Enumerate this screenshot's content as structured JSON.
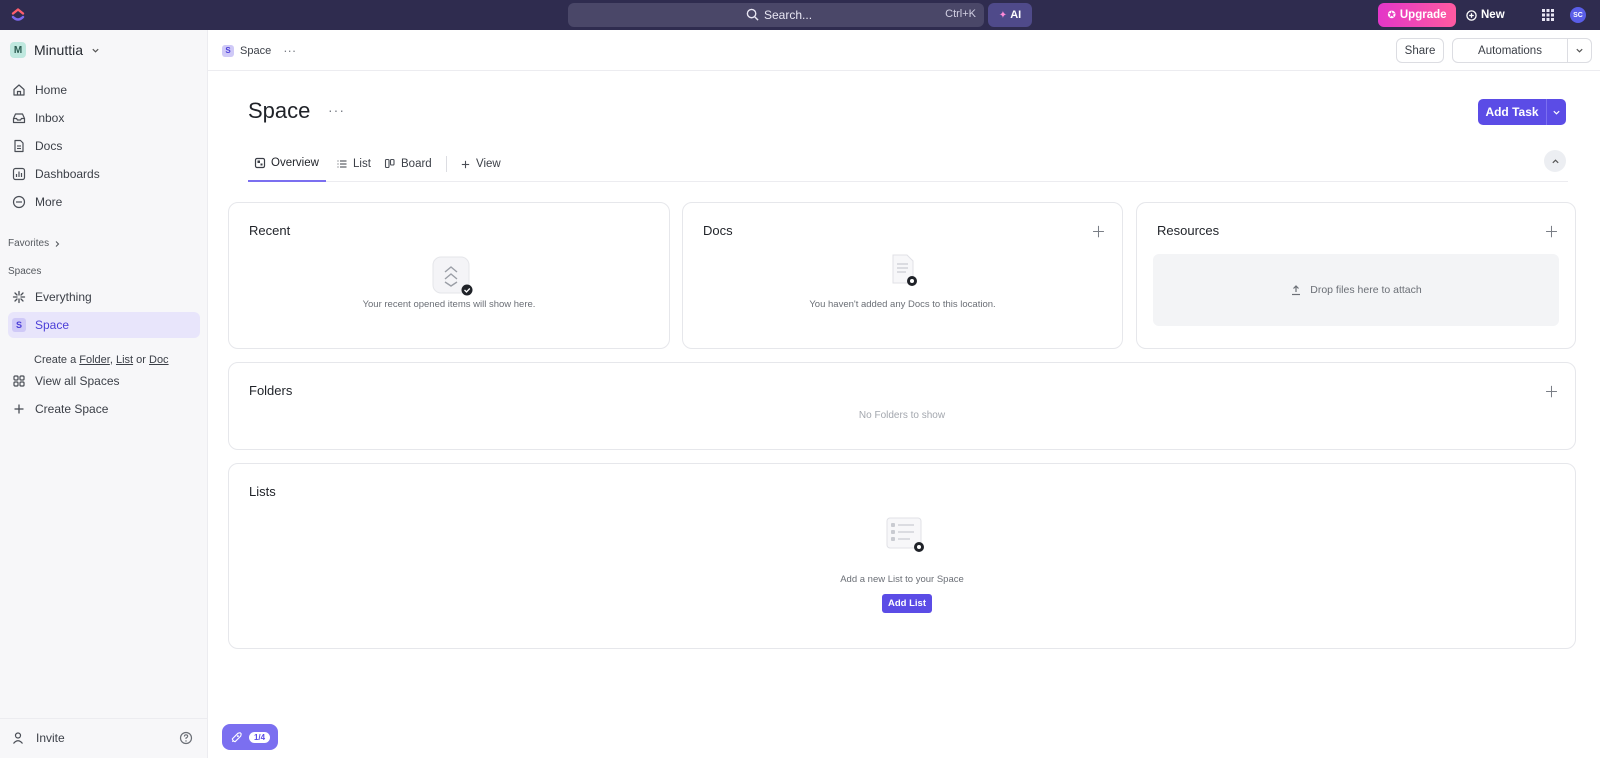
{
  "search": {
    "label": "Search...",
    "shortcut": "Ctrl+K"
  },
  "topbar": {
    "ai_label": "AI",
    "upgrade_label": "Upgrade",
    "new_label": "New",
    "avatar_initials": "SC"
  },
  "workspace": {
    "initial": "M",
    "name": "Minuttia"
  },
  "sidebar": {
    "nav": [
      {
        "label": "Home",
        "icon": "home-icon"
      },
      {
        "label": "Inbox",
        "icon": "inbox-icon"
      },
      {
        "label": "Docs",
        "icon": "doc-icon"
      },
      {
        "label": "Dashboards",
        "icon": "dashboard-icon"
      },
      {
        "label": "More",
        "icon": "more-circle-icon"
      }
    ],
    "favorites_label": "Favorites",
    "spaces_label": "Spaces",
    "everything_label": "Everything",
    "space": {
      "initial": "S",
      "label": "Space"
    },
    "create_prefix": "Create a",
    "create_folder": "Folder",
    "create_list": "List",
    "create_or": "or",
    "create_doc": "Doc",
    "view_all_spaces": "View all Spaces",
    "create_space": "Create Space",
    "invite_label": "Invite"
  },
  "breadcrumb": {
    "initial": "S",
    "label": "Space",
    "more": "···"
  },
  "header_actions": {
    "share": "Share",
    "automations": "Automations"
  },
  "page": {
    "title": "Space",
    "title_more": "···",
    "add_task": "Add Task"
  },
  "tabs": [
    {
      "label": "Overview",
      "icon": "overview-icon",
      "active": true
    },
    {
      "label": "List",
      "icon": "list-icon",
      "active": false
    },
    {
      "label": "Board",
      "icon": "board-icon",
      "active": false
    },
    {
      "label": "View",
      "icon": "plus-icon",
      "active": false
    }
  ],
  "cards": {
    "recent": {
      "title": "Recent",
      "empty": "Your recent opened items will show here."
    },
    "docs": {
      "title": "Docs",
      "empty": "You haven't added any Docs to this location."
    },
    "resources": {
      "title": "Resources",
      "drop": "Drop files here to attach"
    },
    "folders": {
      "title": "Folders",
      "empty": "No Folders to show"
    },
    "lists": {
      "title": "Lists",
      "empty": "Add a new List to your Space",
      "button": "Add List"
    }
  },
  "onboarding": {
    "progress": "1/4"
  },
  "colors": {
    "topbar": "#2f2c4f",
    "accent": "#5b4ce6",
    "sidebar_active": "#e8e5fb",
    "upgrade": "#e336c8"
  }
}
